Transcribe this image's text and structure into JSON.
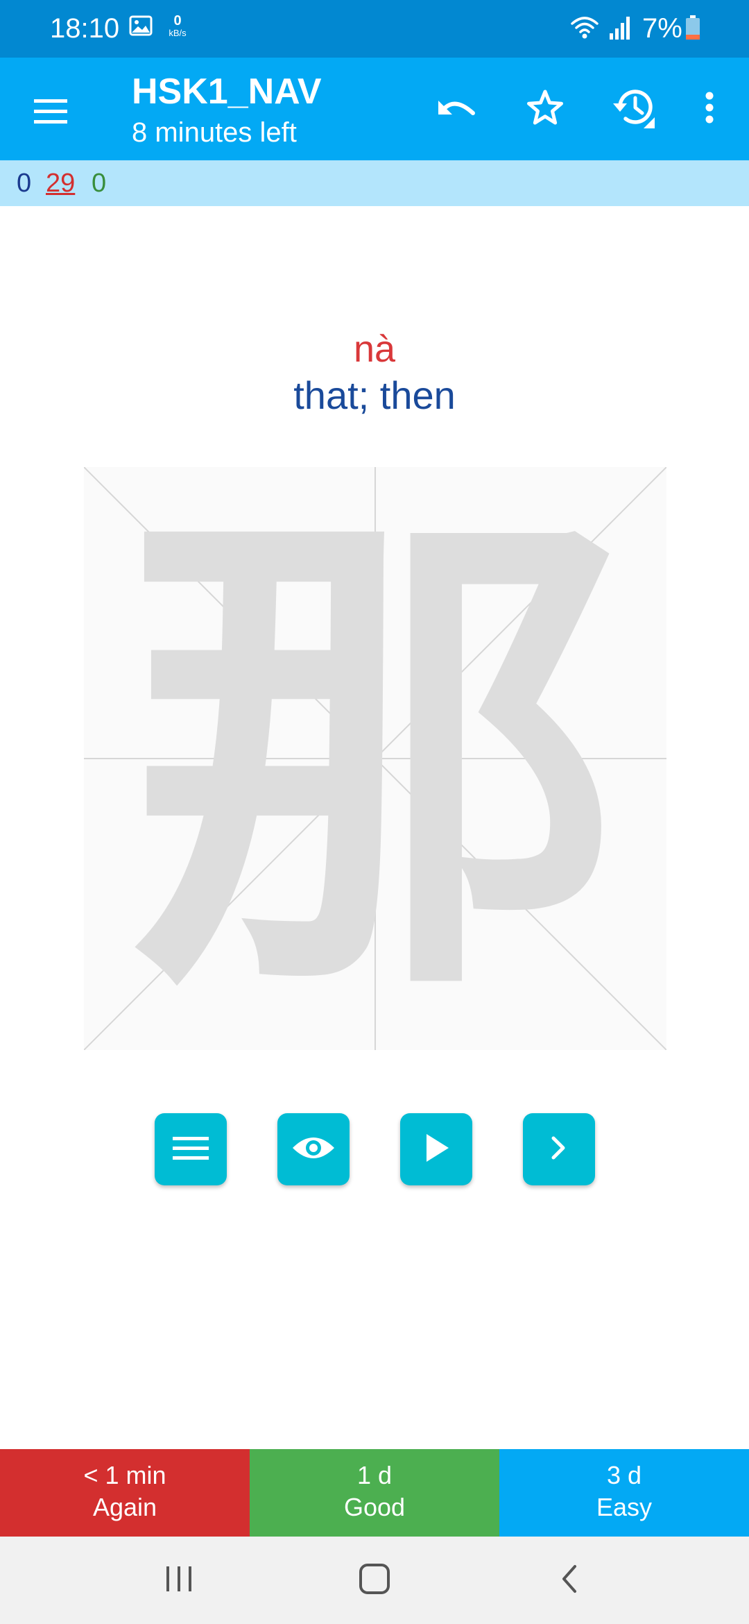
{
  "status_bar": {
    "time": "18:10",
    "net_speed_value": "0",
    "net_speed_unit": "kB/s",
    "battery_percent": "7%",
    "icons": [
      "image-icon",
      "wifi-icon",
      "signal-icon",
      "battery-icon"
    ]
  },
  "app_bar": {
    "title": "HSK1_NAV",
    "subtitle": "8 minutes left",
    "icons": [
      "menu-icon",
      "undo-icon",
      "star-icon",
      "history-icon",
      "more-vert-icon"
    ]
  },
  "counts": {
    "new": "0",
    "learning": "29",
    "review": "0"
  },
  "card": {
    "pinyin": "nà",
    "meaning": "that; then",
    "character": "那"
  },
  "controls": [
    "list-icon",
    "eye-icon",
    "play-icon",
    "chevron-right-icon"
  ],
  "answers": {
    "again": {
      "interval": "< 1 min",
      "label": "Again"
    },
    "good": {
      "interval": "1 d",
      "label": "Good"
    },
    "easy": {
      "interval": "3 d",
      "label": "Easy"
    }
  },
  "colors": {
    "status_bar": "#0288d1",
    "app_bar": "#03a9f4",
    "counts_bar": "#b3e5fc",
    "pinyin": "#d9383a",
    "meaning": "#1a4a9a",
    "control_button": "#00bcd4",
    "again": "#d32f2f",
    "good": "#4caf50",
    "easy": "#03a9f4"
  }
}
